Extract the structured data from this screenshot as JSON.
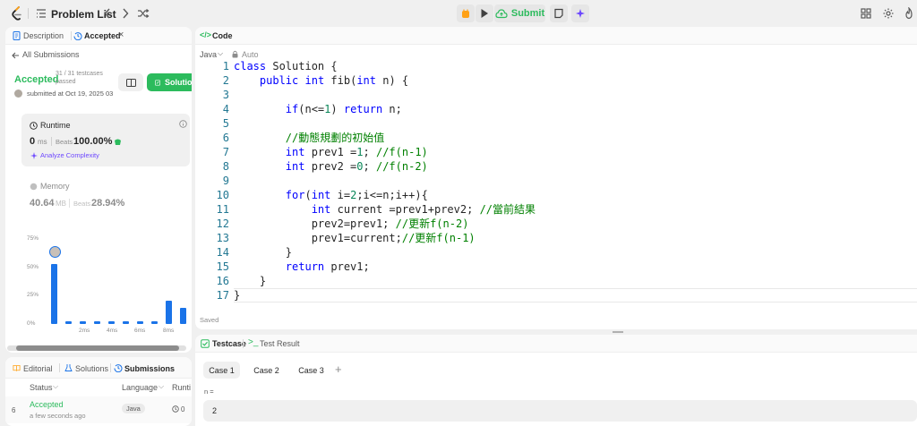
{
  "topbar": {
    "problem_list": "Problem List",
    "submit": "Submit"
  },
  "left": {
    "tabs": [
      {
        "label": "Description"
      },
      {
        "label": "Accepted"
      }
    ],
    "all_submissions": "All Submissions",
    "status": "Accepted",
    "testcases": "31 / 31 testcases",
    "passed": "passed",
    "submitted": "submitted at Oct 19, 2025 03",
    "solution_btn": "Solution",
    "runtime": {
      "title": "Runtime",
      "value": "0",
      "unit": "ms",
      "beats_label": "Beats",
      "beats": "100.00%",
      "analyze": "Analyze Complexity"
    },
    "memory": {
      "title": "Memory",
      "value": "40.64",
      "unit": "MB",
      "beats_label": "Beats",
      "beats": "28.94%"
    },
    "chart": {
      "y_ticks": [
        "75%",
        "50%",
        "25%",
        "0%"
      ],
      "x_ticks": [
        "2ms",
        "4ms",
        "6ms",
        "8ms"
      ]
    },
    "bottom_tabs": [
      {
        "label": "Editorial"
      },
      {
        "label": "Solutions"
      },
      {
        "label": "Submissions"
      }
    ],
    "table": {
      "headers": [
        "Status",
        "Language",
        "Runti"
      ],
      "row": {
        "index": "6",
        "status": "Accepted",
        "time": "a few seconds ago",
        "language": "Java",
        "runtime": "0 "
      }
    }
  },
  "chart_data": {
    "type": "bar",
    "categories": [
      "0ms",
      "1ms",
      "2ms",
      "3ms",
      "4ms",
      "5ms",
      "6ms",
      "7ms",
      "8ms",
      "9ms"
    ],
    "values": [
      52,
      2,
      2,
      2,
      2,
      2,
      2,
      2,
      20,
      14
    ],
    "ylim": [
      0,
      75
    ],
    "y_ticks": [
      "75%",
      "50%",
      "25%",
      "0%"
    ],
    "x_ticks": [
      "2ms",
      "4ms",
      "6ms",
      "8ms"
    ]
  },
  "code": {
    "title": "Code",
    "language": "Java",
    "auto": "Auto",
    "saved": "Saved",
    "lines": [
      "class Solution {",
      "    public int fib(int n) {",
      "",
      "        if(n<=1) return n;",
      "",
      "        //動態規劃的初始值",
      "        int prev1 =1; //f(n-1)",
      "        int prev2 =0; //f(n-2)",
      "",
      "        for(int i=2;i<=n;i++){",
      "            int current =prev1+prev2; //當前結果",
      "            prev2=prev1; //更新f(n-2)",
      "            prev1=current;//更新f(n-1)",
      "        }",
      "        return prev1;",
      "    }",
      "}"
    ]
  },
  "testcase": {
    "tab_testcase": "Testcase",
    "tab_result": "Test Result",
    "cases": [
      "Case 1",
      "Case 2",
      "Case 3"
    ],
    "var_label": "n =",
    "var_value": "2"
  }
}
